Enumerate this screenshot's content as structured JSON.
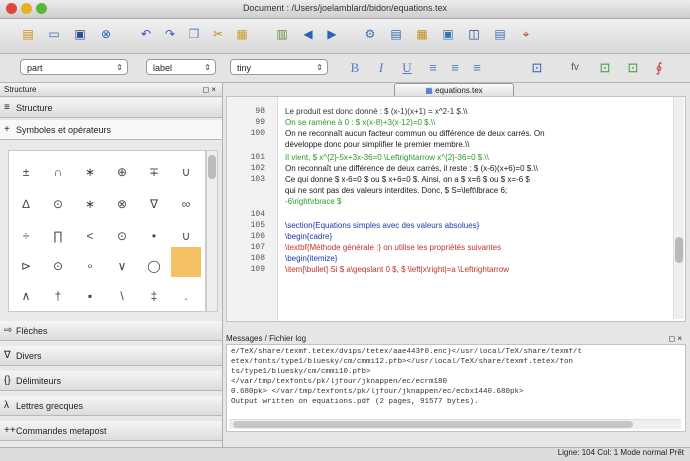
{
  "window": {
    "title": "Document : /Users/joelamblard/bidon/equations.tex"
  },
  "toolbar": {
    "icons": [
      "new-icon",
      "open-icon",
      "save-icon",
      "close-icon",
      "undo-icon",
      "redo-icon",
      "copy-icon",
      "cut-icon",
      "paste-icon",
      "compile-icon",
      "prev-icon",
      "next-icon",
      "quick-build-icon",
      "latex-icon",
      "pdflatex-icon",
      "dvi-icon",
      "view-icon",
      "bibtex-icon",
      "pdf-icon"
    ]
  },
  "formatbar": {
    "combo1": "part",
    "combo2": "label",
    "combo3": "tiny",
    "buttons": [
      "B",
      "I",
      "U",
      "≡",
      "≡",
      "≡",
      "⊡",
      "fv",
      "⊡",
      "⊡",
      "∮"
    ]
  },
  "leftpanel": {
    "title": "Structure",
    "structure_label": "Structure",
    "symbols_label": "Symboles et opérateurs",
    "symbols": [
      "±",
      "∩",
      "∗",
      "⊕",
      "∓",
      "∪",
      "∆",
      "⊙",
      "∗",
      "⊗",
      "∇",
      "∞",
      "÷",
      "∏",
      "<",
      "⊙",
      "•",
      "∪",
      "⊳",
      "⊙",
      "∘",
      "∨",
      "◯",
      "",
      "∧",
      "†",
      "▪",
      "\\",
      "‡",
      "."
    ],
    "sections": [
      "Flèches",
      "Divers",
      "Délimiteurs",
      "Lettres grecques",
      "Commandes metapost"
    ]
  },
  "editor": {
    "tab_label": "equations.tex",
    "lines": [
      {
        "num": "98",
        "text": "Le produit est donc donné : $ (x-1)(x+1) = x^2-1 $.\\\\"
      },
      {
        "num": "99",
        "text": "On se ramène à 0 : $ x(x-8)+3(x-12)=0 $.\\\\"
      },
      {
        "num": "100",
        "text": "On ne reconnaît aucun facteur commun ou différence de deux carrés. On"
      },
      {
        "num": "",
        "text": "développe donc pour simplifier le premier membre.\\\\"
      },
      {
        "num": "101",
        "text": "Il vient, $ x^{2}-5x+3x-36=0 \\Leftrightarrow x^{2}-36=0 $.\\\\"
      },
      {
        "num": "102",
        "text": "On reconnaît une différence de deux carrés, il reste : $ (x-6)(x+6)=0 $.\\\\"
      },
      {
        "num": "103",
        "text": "Ce qui donne $ x-6=0 $ ou $ x+6=0 $. Ainsi, on a $ x=6 $ ou $ x=-6 $"
      },
      {
        "num": "",
        "text": "qui ne sont pas des valeurs interdites. Donc, $ S=\\left\\lbrace 6;"
      },
      {
        "num": "",
        "text": "-6\\right\\rbrace $"
      },
      {
        "num": "104",
        "text": ""
      },
      {
        "num": "105",
        "text": "\\section{Équations simples avec des valeurs absolues}"
      },
      {
        "num": "106",
        "text": "\\begin{cadre}"
      },
      {
        "num": "107",
        "text": "\\textbf{Méthode générale :} on utilise les propriétés suivantes"
      },
      {
        "num": "108",
        "text": "\\begin{itemize}"
      },
      {
        "num": "109",
        "text": "\\item[\\bullet] Si $ a\\geqslant 0 $, $ \\left|x\\right|=a \\Leftrightarrow"
      }
    ]
  },
  "messages": {
    "header": "Messages / Fichier log",
    "lines": [
      "e/TeX/share/texmf.tetex/dvips/tetex/aae443f0.enc}</usr/local/TeX/share/texmf/t",
      "etex/fonts/type1/bluesky/cm/cmmi12.pfb></usr/local/TeX/share/texmf.tetex/fon",
      "ts/type1/bluesky/cm/cmmi10.pfb>",
      "</var/tmp/texfonts/pk/ljfour/jknappen/ec/ecrm180",
      "0.680pk> </var/tmp/texfonts/pk/ljfour/jknappen/ec/ecbx1440.680pk>",
      "Output written on equations.pdf (2 pages, 91577 bytes)."
    ]
  },
  "status": {
    "text": "Ligne: 104 Col: 1 Mode normal Prêt"
  }
}
